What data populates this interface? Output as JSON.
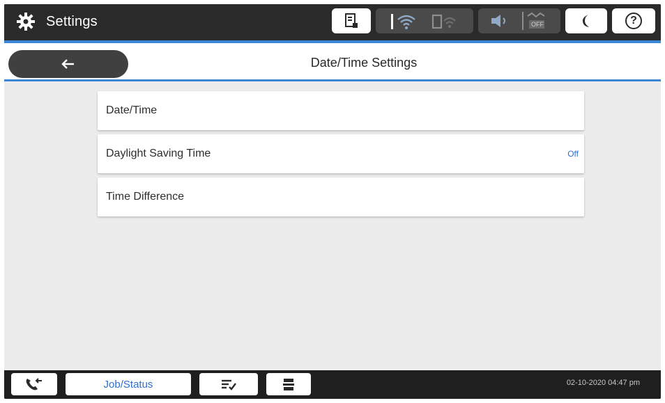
{
  "topbar": {
    "title": "Settings",
    "icons": [
      "gear-icon",
      "memory-device-icon",
      "wifi-icon",
      "wifi-direct-icon",
      "sound-icon",
      "eco-mode-off-icon",
      "sleep-moon-icon",
      "help-icon"
    ],
    "eco_off_label": "OFF",
    "help_glyph": "?"
  },
  "header": {
    "back_icon": "back-arrow-icon",
    "title": "Date/Time Settings"
  },
  "list": {
    "items": [
      {
        "label": "Date/Time",
        "value": ""
      },
      {
        "label": "Daylight Saving Time",
        "value": "Off"
      },
      {
        "label": "Time Difference",
        "value": ""
      }
    ]
  },
  "bottombar": {
    "job_status_label": "Job/Status",
    "datetime": "02-10-2020 04:47 pm",
    "icons": [
      "phone-redial-icon",
      "fax-send-icon",
      "fax-receive-icon"
    ]
  },
  "colors": {
    "accent": "#3b86d6",
    "value_text": "#2d6fd0",
    "bar_background": "#1f1f1f",
    "content_background": "#ececec"
  }
}
